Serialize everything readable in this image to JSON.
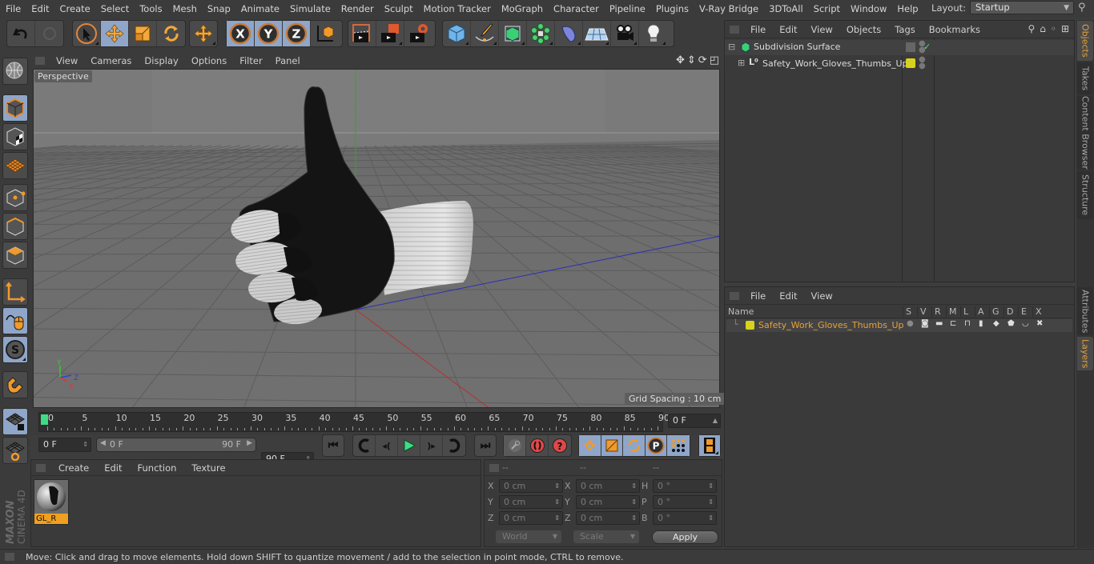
{
  "menubar": {
    "items": [
      "File",
      "Edit",
      "Create",
      "Select",
      "Tools",
      "Mesh",
      "Snap",
      "Animate",
      "Simulate",
      "Render",
      "Sculpt",
      "Motion Tracker",
      "MoGraph",
      "Character",
      "Pipeline",
      "Plugins",
      "V-Ray Bridge",
      "3DToAll",
      "Script",
      "Window",
      "Help"
    ],
    "layout_label": "Layout:",
    "layout_value": "Startup"
  },
  "toolbar": {
    "groups": [
      [
        "undo-icon",
        "redo-icon"
      ],
      [
        "live-selection-icon",
        "move-icon",
        "scale-icon",
        "rotate-icon"
      ],
      [
        "recent-tool-icon"
      ],
      [
        "x-axis-lock-icon",
        "y-axis-lock-icon",
        "z-axis-lock-icon",
        "coordinate-system-icon"
      ],
      [
        "render-view-icon",
        "render-to-picture-viewer-icon",
        "render-settings-icon"
      ],
      [
        "cube-object-icon",
        "pen-spline-icon",
        "subdivision-surface-icon",
        "cloner-icon",
        "deformer-icon",
        "floor-icon",
        "camera-icon",
        "light-icon"
      ]
    ]
  },
  "viewport": {
    "menu": [
      "View",
      "Cameras",
      "Display",
      "Options",
      "Filter",
      "Panel"
    ],
    "camera_label": "Perspective",
    "grid_spacing": "Grid Spacing : 10 cm",
    "axis_labels": {
      "x": "X",
      "y": "Y",
      "z": "Z"
    }
  },
  "timeline": {
    "ticks": [
      "0",
      "5",
      "10",
      "15",
      "20",
      "25",
      "30",
      "35",
      "40",
      "45",
      "50",
      "55",
      "60",
      "65",
      "70",
      "75",
      "80",
      "85",
      "90"
    ],
    "current_frame": "0 F",
    "start_frame": "0 F",
    "range_start": "0 F",
    "range_end": "90 F",
    "end_frame": "90 F"
  },
  "material_manager": {
    "menu": [
      "Create",
      "Edit",
      "Function",
      "Texture"
    ],
    "materials": [
      {
        "name": "GL_R"
      }
    ]
  },
  "coordinates": {
    "headers": [
      "--",
      "--",
      "--"
    ],
    "rows": [
      {
        "l1": "X",
        "v1": "0 cm",
        "l2": "X",
        "v2": "0 cm",
        "l3": "H",
        "v3": "0 °"
      },
      {
        "l1": "Y",
        "v1": "0 cm",
        "l2": "Y",
        "v2": "0 cm",
        "l3": "P",
        "v3": "0 °"
      },
      {
        "l1": "Z",
        "v1": "0 cm",
        "l2": "Z",
        "v2": "0 cm",
        "l3": "B",
        "v3": "0 °"
      }
    ],
    "space": "World",
    "mode": "Scale",
    "apply_label": "Apply"
  },
  "object_manager": {
    "menu": [
      "File",
      "Edit",
      "View",
      "Objects",
      "Tags",
      "Bookmarks"
    ],
    "objects": [
      {
        "name": "Subdivision Surface",
        "level": 0,
        "expander": "−"
      },
      {
        "name": "Safety_Work_Gloves_Thumbs_Up",
        "level": 1,
        "expander": "+",
        "layer_color": "#d8d21e"
      }
    ]
  },
  "layer_manager": {
    "menu": [
      "File",
      "Edit",
      "View"
    ],
    "columns": [
      "Name",
      "S",
      "V",
      "R",
      "M",
      "L",
      "A",
      "G",
      "D",
      "E",
      "X"
    ],
    "layers": [
      {
        "name": "Safety_Work_Gloves_Thumbs_Up",
        "color": "#d8d21e"
      }
    ]
  },
  "right_tabs": {
    "top": [
      "Objects",
      "Takes",
      "Content Browser",
      "Structure"
    ],
    "bottom": [
      "Attributes",
      "Layers"
    ]
  },
  "brand": {
    "maker": "MAXON",
    "product": "CINEMA 4D"
  },
  "status": "Move: Click and drag to move elements. Hold down SHIFT to quantize movement / add to the selection in point mode, CTRL to remove.",
  "colors": {
    "accent": "#e7a23a",
    "selected": "#8fa6c9",
    "layer": "#d8d21e",
    "green_frame": "#3fdc86"
  }
}
